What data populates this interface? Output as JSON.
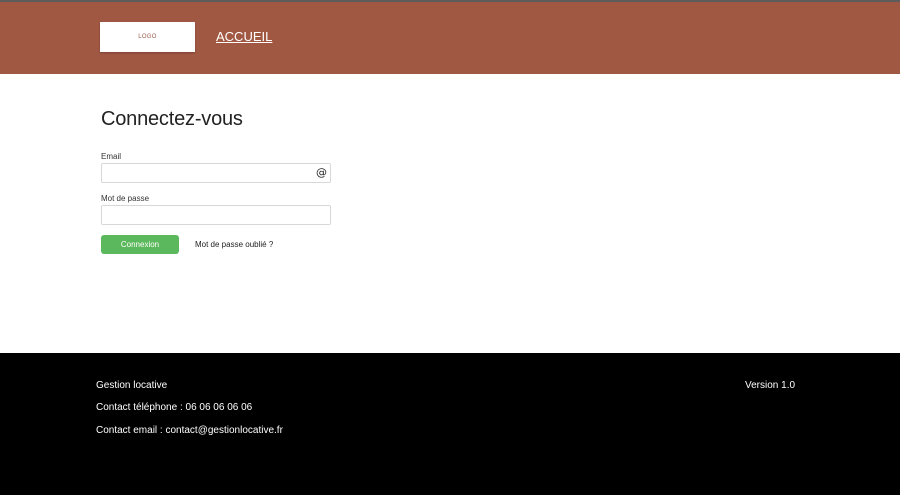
{
  "header": {
    "logo_text": "LOGO",
    "nav_home": "ACCUEIL",
    "background": "#a15843"
  },
  "login": {
    "title": "Connectez-vous",
    "email_label": "Email",
    "email_value": "",
    "email_icon": "at-icon",
    "email_icon_glyph": "@",
    "password_label": "Mot de passe",
    "password_value": "",
    "submit_label": "Connexion",
    "submit_color": "#5cb85c",
    "forgot_link": "Mot de passe oublié ?"
  },
  "footer": {
    "app_name": "Gestion locative",
    "phone": "Contact téléphone : 06 06 06 06 06",
    "email": "Contact email : contact@gestionlocative.fr",
    "version": "Version 1.0",
    "background": "#000000"
  }
}
